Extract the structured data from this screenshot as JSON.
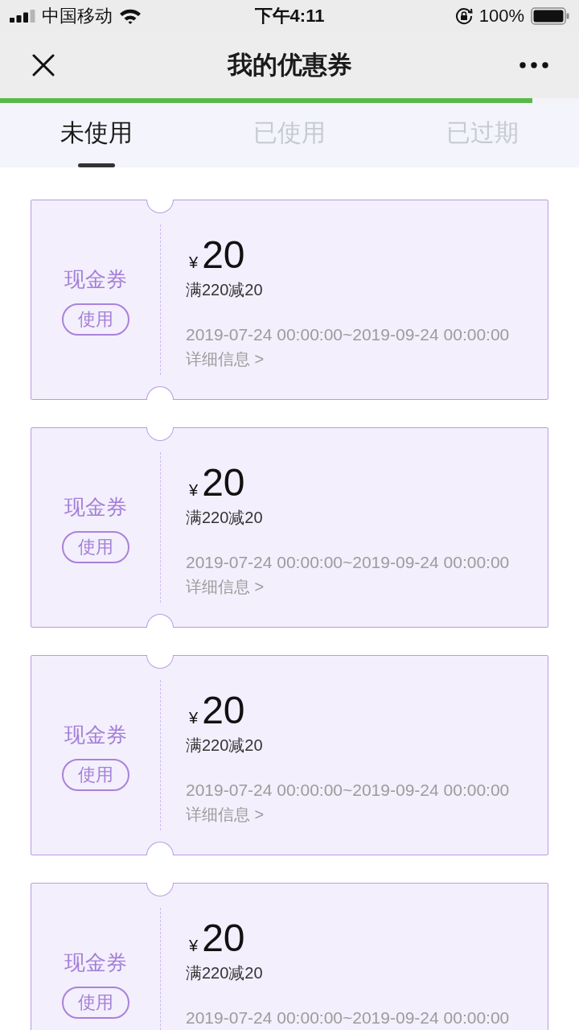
{
  "status_bar": {
    "carrier": "中国移动",
    "time": "下午4:11",
    "battery": "100%"
  },
  "nav_bar": {
    "title": "我的优惠券"
  },
  "loading_bar": {
    "level": 0.92
  },
  "tabs": [
    {
      "label": "未使用",
      "selected": true
    },
    {
      "label": "已使用",
      "selected": false
    },
    {
      "label": "已过期",
      "selected": false
    }
  ],
  "coupons": [
    {
      "type": "现金券",
      "button": "使用",
      "currency": "¥",
      "amount": "20",
      "condition": "满220减20",
      "validity": "2019-07-24 00:00:00~2019-09-24 00:00:00",
      "details": "详细信息 >"
    },
    {
      "type": "现金券",
      "button": "使用",
      "currency": "¥",
      "amount": "20",
      "condition": "满220减20",
      "validity": "2019-07-24 00:00:00~2019-09-24 00:00:00",
      "details": "详细信息 >"
    },
    {
      "type": "现金券",
      "button": "使用",
      "currency": "¥",
      "amount": "20",
      "condition": "满220减20",
      "validity": "2019-07-24 00:00:00~2019-09-24 00:00:00",
      "details": "详细信息 >"
    },
    {
      "type": "现金券",
      "button": "使用",
      "currency": "¥",
      "amount": "20",
      "condition": "满220减20",
      "validity": "2019-07-24 00:00:00~2019-09-24 00:00:00"
    }
  ]
}
